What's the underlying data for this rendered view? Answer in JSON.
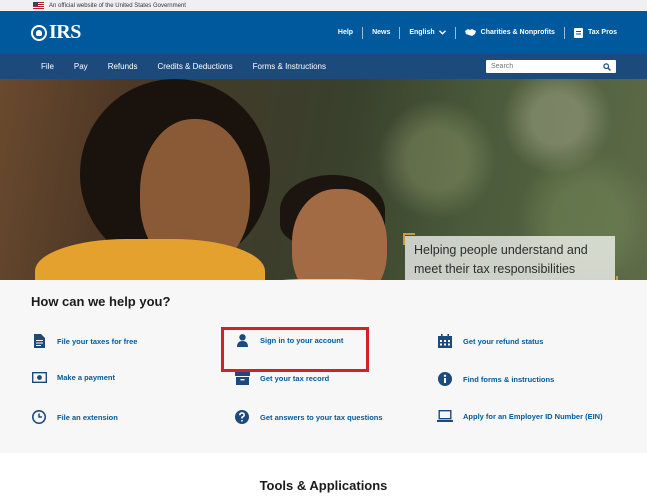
{
  "gov_banner": {
    "text": "An official website of the United States Government"
  },
  "header": {
    "logo": "IRS",
    "util": {
      "help": "Help",
      "news": "News",
      "language": "English",
      "charities": "Charities & Nonprofits",
      "tax_pros": "Tax Pros"
    }
  },
  "nav": {
    "items": [
      "File",
      "Pay",
      "Refunds",
      "Credits & Deductions",
      "Forms & Instructions"
    ],
    "search_placeholder": "Search"
  },
  "hero": {
    "tagline_line1": "Helping people understand and",
    "tagline_line2": "meet their tax responsibilities"
  },
  "help": {
    "title": "How can we help you?",
    "links": [
      {
        "label": "File your taxes for free",
        "icon": "document-icon"
      },
      {
        "label": "Sign in to your account",
        "icon": "person-icon"
      },
      {
        "label": "Get your refund status",
        "icon": "calendar-icon"
      },
      {
        "label": "Make a payment",
        "icon": "money-icon"
      },
      {
        "label": "Get your tax record",
        "icon": "archive-box-icon"
      },
      {
        "label": "Find forms & instructions",
        "icon": "info-icon"
      },
      {
        "label": "File an extension",
        "icon": "clock-icon"
      },
      {
        "label": "Get answers to your tax questions",
        "icon": "question-icon"
      },
      {
        "label": "Apply for an Employer ID Number (EIN)",
        "icon": "laptop-icon"
      }
    ]
  },
  "tools": {
    "title": "Tools & Applications"
  },
  "colors": {
    "header_blue": "#00599c",
    "nav_navy": "#1d4a7c",
    "highlight_red": "#d42027",
    "link_blue": "#00599c"
  }
}
